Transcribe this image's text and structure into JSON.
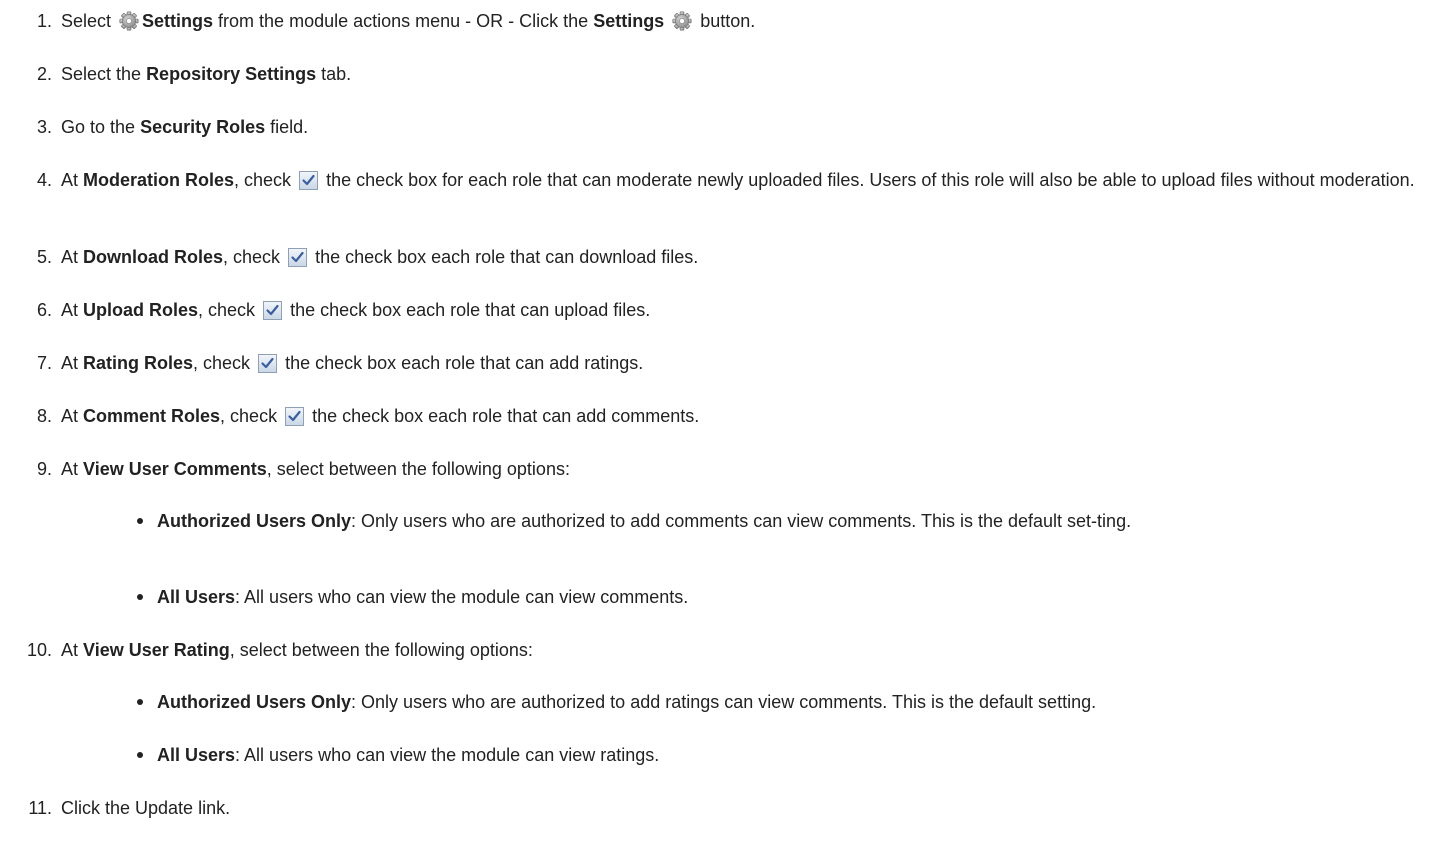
{
  "steps": [
    {
      "n": "1.",
      "parts": [
        {
          "t": "Select "
        },
        {
          "icon": "gear-icon"
        },
        {
          "b": "Settings"
        },
        {
          "t": " from the module actions menu - OR - Click the "
        },
        {
          "b": "Settings"
        },
        {
          "t": " "
        },
        {
          "icon": "gear-icon"
        },
        {
          "t": " button."
        }
      ]
    },
    {
      "n": "2.",
      "parts": [
        {
          "t": "Select the "
        },
        {
          "b": "Repository Settings"
        },
        {
          "t": " tab."
        }
      ]
    },
    {
      "n": "3.",
      "parts": [
        {
          "t": "Go to the "
        },
        {
          "b": "Security Roles"
        },
        {
          "t": " field."
        }
      ]
    },
    {
      "n": "4.",
      "parts": [
        {
          "t": "At "
        },
        {
          "b": "Moderation Roles"
        },
        {
          "t": ", check "
        },
        {
          "icon": "checkbox-icon"
        },
        {
          "t": " the check box for each role that can moderate newly uploaded files. Users of this role will also be able to upload files without moderation."
        }
      ]
    },
    {
      "n": "5.",
      "parts": [
        {
          "t": "At "
        },
        {
          "b": "Download Roles"
        },
        {
          "t": ", check "
        },
        {
          "icon": "checkbox-icon"
        },
        {
          "t": " the check box each role that can download files."
        }
      ]
    },
    {
      "n": "6.",
      "parts": [
        {
          "t": "At "
        },
        {
          "b": "Upload Roles"
        },
        {
          "t": ", check "
        },
        {
          "icon": "checkbox-icon"
        },
        {
          "t": " the check box each role that can upload files."
        }
      ]
    },
    {
      "n": "7.",
      "parts": [
        {
          "t": "At "
        },
        {
          "b": "Rating Roles"
        },
        {
          "t": ", check "
        },
        {
          "icon": "checkbox-icon"
        },
        {
          "t": " the check box each role that can add ratings."
        }
      ]
    },
    {
      "n": "8.",
      "parts": [
        {
          "t": "At "
        },
        {
          "b": "Comment Roles"
        },
        {
          "t": ", check "
        },
        {
          "icon": "checkbox-icon"
        },
        {
          "t": " the check box each role that can add comments."
        }
      ]
    },
    {
      "n": "9.",
      "parts": [
        {
          "t": "At "
        },
        {
          "b": "View User Comments"
        },
        {
          "t": ", select between the following options:"
        }
      ],
      "bullets": [
        [
          {
            "b": "Authorized Users Only"
          },
          {
            "t": ": Only users who are authorized to add comments can view comments. This is the default set-ting."
          }
        ],
        [
          {
            "b": "All Users"
          },
          {
            "t": ": All users who can view the module can view comments."
          }
        ]
      ]
    },
    {
      "n": "10.",
      "parts": [
        {
          "t": "At "
        },
        {
          "b": "View User Rating"
        },
        {
          "t": ", select between the following options:"
        }
      ],
      "bullets": [
        [
          {
            "b": "Authorized Users Only"
          },
          {
            "t": ": Only users who are authorized to add ratings can view comments. This is the default setting."
          }
        ],
        [
          {
            "b": "All Users"
          },
          {
            "t": ": All users who can view the module can view ratings."
          }
        ]
      ]
    },
    {
      "n": "11.",
      "parts": [
        {
          "t": "Click the Update link."
        }
      ]
    }
  ]
}
